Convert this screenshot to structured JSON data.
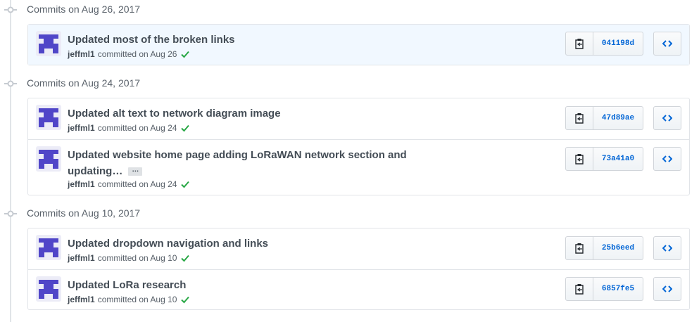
{
  "groups": [
    {
      "title": "Commits on Aug 26, 2017",
      "commits": [
        {
          "message": "Updated most of the broken links",
          "author": "jeffml1",
          "committed_text": "committed on Aug 26",
          "sha": "041198d",
          "highlight": true,
          "status": "success"
        }
      ]
    },
    {
      "title": "Commits on Aug 24, 2017",
      "commits": [
        {
          "message": "Updated alt text to network diagram image",
          "author": "jeffml1",
          "committed_text": "committed on Aug 24",
          "sha": "47d89ae",
          "status": "success"
        },
        {
          "message": "Updated website home page adding LoRaWAN network section and",
          "message_line2": "updating…",
          "has_more": true,
          "more_label": "…",
          "author": "jeffml1",
          "committed_text": "committed on Aug 24",
          "sha": "73a41a0",
          "status": "success"
        }
      ]
    },
    {
      "title": "Commits on Aug 10, 2017",
      "commits": [
        {
          "message": "Updated dropdown navigation and links",
          "author": "jeffml1",
          "committed_text": "committed on Aug 10",
          "sha": "25b6eed",
          "status": "success"
        },
        {
          "message": "Updated LoRa research",
          "author": "jeffml1",
          "committed_text": "committed on Aug 10",
          "sha": "6857fe5",
          "status": "success"
        }
      ]
    }
  ],
  "icons": {
    "copy": "clippy-icon",
    "browse": "code-icon",
    "status": "check-icon",
    "timeline": "commit-icon"
  },
  "colors": {
    "sha_link": "#0366d6",
    "check": "#28a745",
    "highlight_bg": "#f1f8ff",
    "avatar": "#5046c8"
  }
}
